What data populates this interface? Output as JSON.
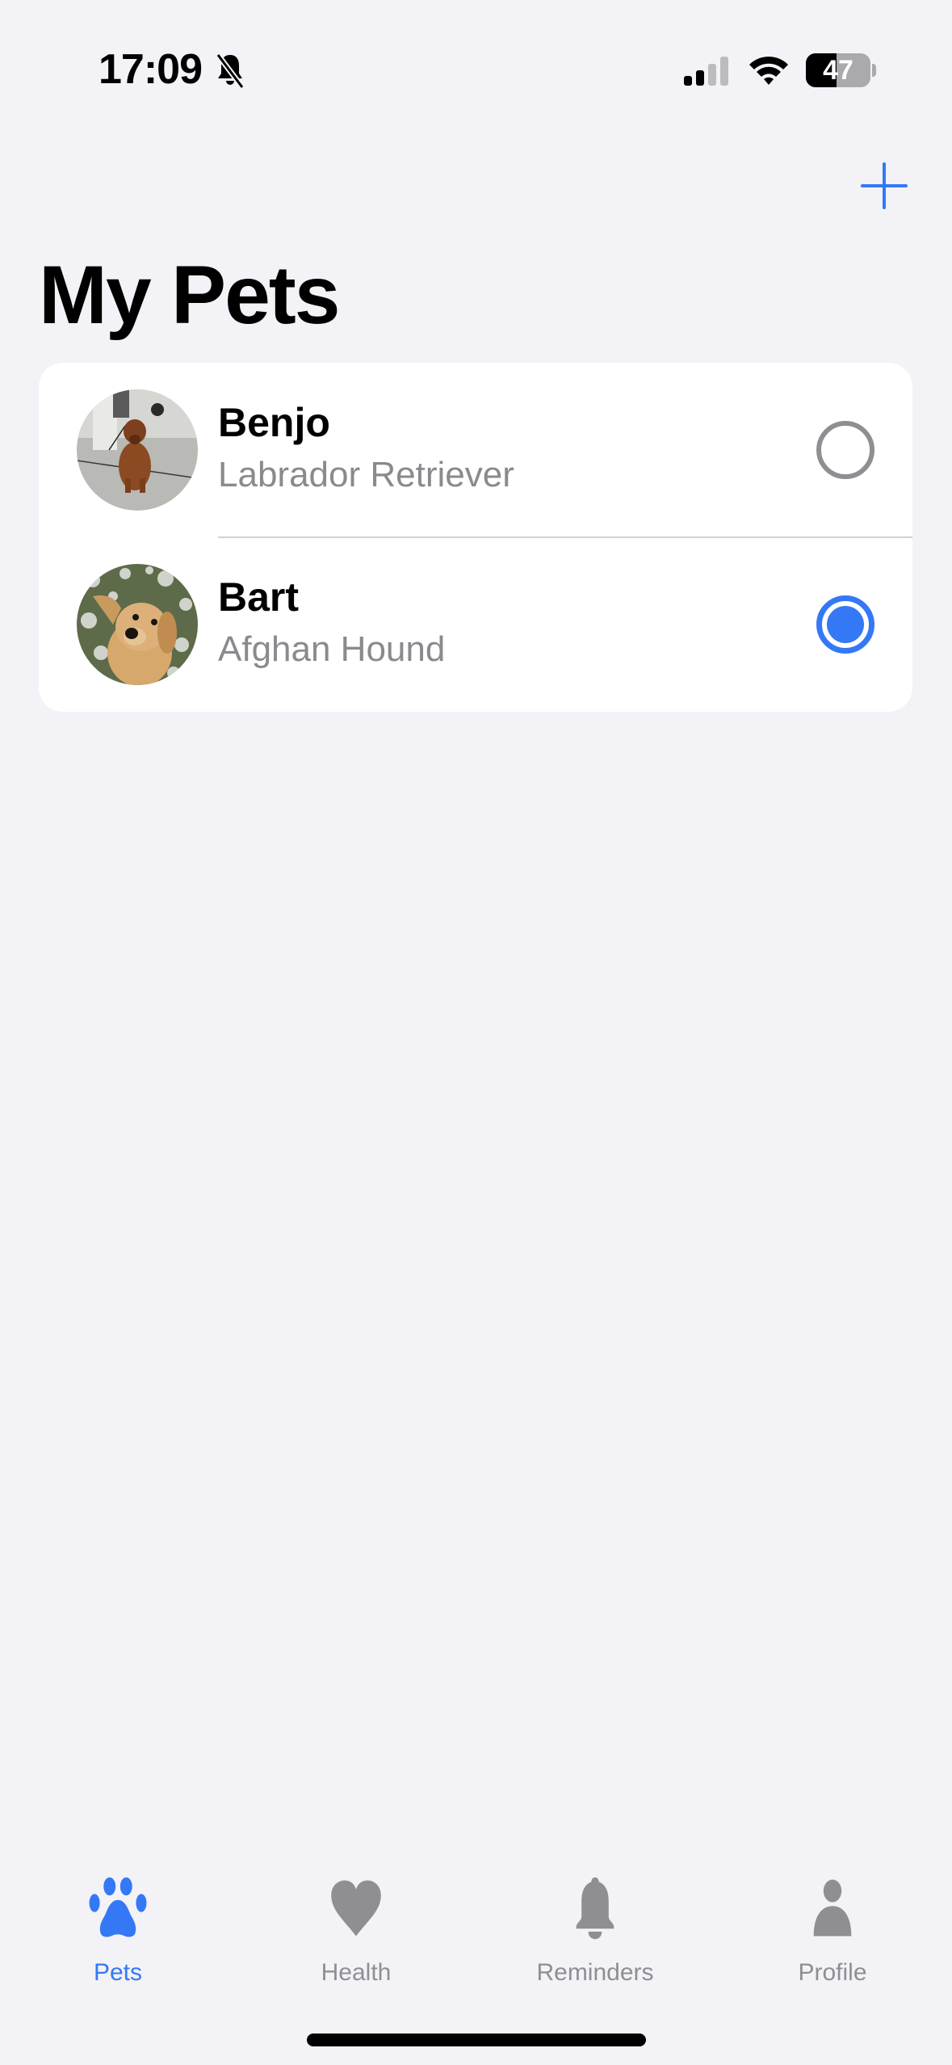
{
  "status_bar": {
    "time": "17:09",
    "silent_mode_icon": "bell-slash-icon",
    "signal_bars_active": 2,
    "signal_bars_total": 4,
    "wifi_icon": "wifi-icon",
    "battery_percent": 47,
    "battery_label": "47"
  },
  "header": {
    "title": "My Pets",
    "add_button_icon": "plus-icon",
    "accent_color": "#3478f6"
  },
  "pets": [
    {
      "name": "Benjo",
      "breed": "Labrador Retriever",
      "photo": "dog-photo-benjo",
      "selected": false
    },
    {
      "name": "Bart",
      "breed": "Afghan Hound",
      "photo": "dog-photo-bart",
      "selected": true
    }
  ],
  "tab_bar": {
    "active_index": 0,
    "tabs": [
      {
        "label": "Pets",
        "icon": "paw-icon"
      },
      {
        "label": "Health",
        "icon": "heart-icon"
      },
      {
        "label": "Reminders",
        "icon": "bell-icon"
      },
      {
        "label": "Profile",
        "icon": "person-icon"
      }
    ]
  }
}
